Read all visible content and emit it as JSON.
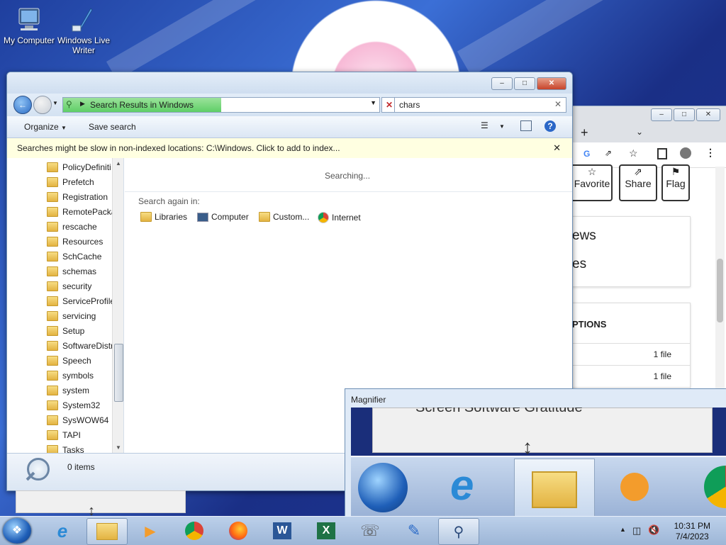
{
  "desktop": {
    "icons": [
      {
        "name": "computer-icon",
        "label": "My Computer"
      },
      {
        "name": "windows-live-writer-icon",
        "label": "Windows Live Writer"
      }
    ]
  },
  "explorer": {
    "address": "Search Results in Windows",
    "search_value": "chars",
    "toolbar": {
      "organize": "Organize",
      "save_search": "Save search"
    },
    "infobar": "Searches might be slow in non-indexed locations: C:\\Windows. Click to add to index...",
    "tree": [
      "PolicyDefiniti",
      "Prefetch",
      "Registration",
      "RemotePacka",
      "rescache",
      "Resources",
      "SchCache",
      "schemas",
      "security",
      "ServiceProfile",
      "servicing",
      "Setup",
      "SoftwareDistri",
      "Speech",
      "symbols",
      "system",
      "System32",
      "SysWOW64",
      "TAPI",
      "Tasks"
    ],
    "status": "Searching...",
    "search_again": "Search again in:",
    "locations": [
      "Libraries",
      "Computer",
      "Custom...",
      "Internet"
    ],
    "items_count": "0 items"
  },
  "chrome": {
    "buttons": [
      "Favorite",
      "Share",
      "Flag"
    ],
    "partial_texts": [
      "ews",
      "es"
    ],
    "section_title": "PTIONS",
    "rows": [
      "1 file",
      "1 file"
    ]
  },
  "magnifier": {
    "title": "Magnifier",
    "partial_text": "Screen Software Gratitude"
  },
  "taskbar": {
    "apps": [
      "internet-explorer",
      "windows-explorer",
      "media-player",
      "chrome",
      "firefox",
      "word",
      "excel",
      "remote-tool",
      "writer",
      "magnifier"
    ],
    "clock": {
      "time": "10:31 PM",
      "date": "7/4/2023"
    }
  }
}
